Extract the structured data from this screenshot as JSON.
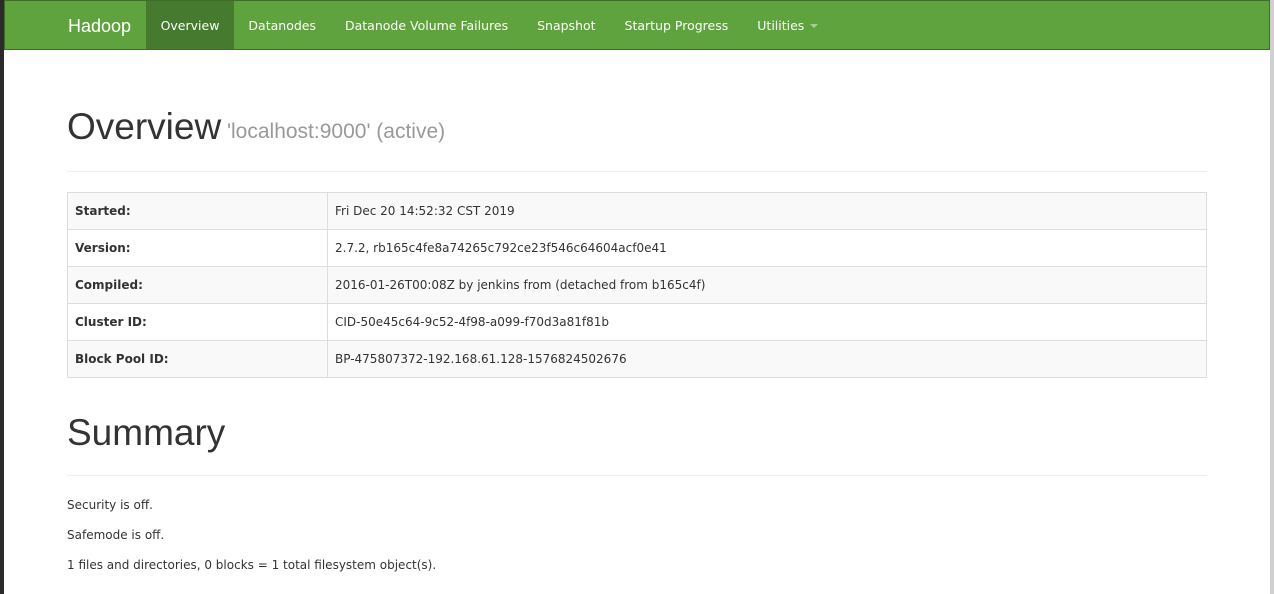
{
  "navbar": {
    "brand": "Hadoop",
    "items": [
      {
        "label": "Overview",
        "active": true
      },
      {
        "label": "Datanodes"
      },
      {
        "label": "Datanode Volume Failures"
      },
      {
        "label": "Snapshot"
      },
      {
        "label": "Startup Progress"
      },
      {
        "label": "Utilities"
      }
    ]
  },
  "overview": {
    "title": "Overview",
    "subtitle": "'localhost:9000' (active)",
    "rows": [
      {
        "label": "Started:",
        "value": "Fri Dec 20 14:52:32 CST 2019"
      },
      {
        "label": "Version:",
        "value": "2.7.2, rb165c4fe8a74265c792ce23f546c64604acf0e41"
      },
      {
        "label": "Compiled:",
        "value": "2016-01-26T00:08Z by jenkins from (detached from b165c4f)"
      },
      {
        "label": "Cluster ID:",
        "value": "CID-50e45c64-9c52-4f98-a099-f70d3a81f81b"
      },
      {
        "label": "Block Pool ID:",
        "value": "BP-475807372-192.168.61.128-1576824502676"
      }
    ]
  },
  "summary": {
    "title": "Summary",
    "lines": [
      "Security is off.",
      "Safemode is off.",
      "1 files and directories, 0 blocks = 1 total filesystem object(s)."
    ]
  },
  "colors": {
    "navbar_bg": "#5fa33e",
    "navbar_active": "#467a2e"
  }
}
